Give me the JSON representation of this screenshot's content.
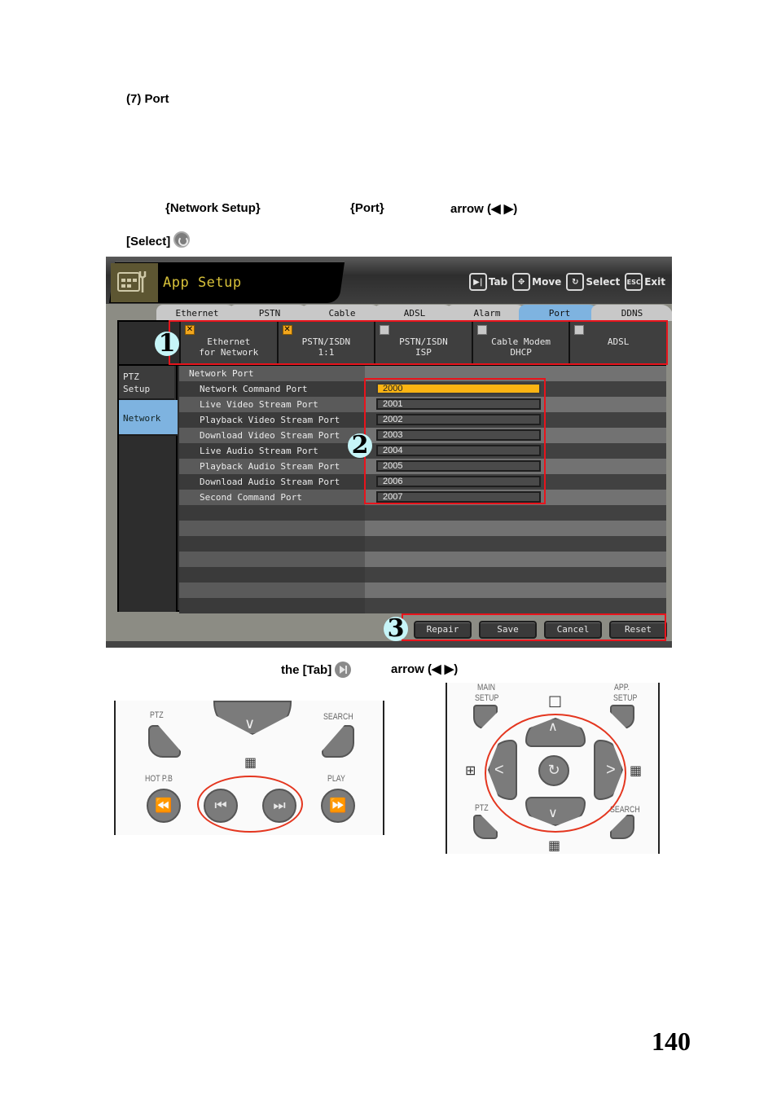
{
  "section_title": "(7) Port",
  "instructions": {
    "menu_path": "{Network Setup}",
    "menu_item": "{Port}",
    "arrow_text": "arrow (◀ ▶)",
    "select_label": "[Select]",
    "select_icon": "select-button-icon",
    "tab_text": "the [Tab]",
    "tab_icon": "tab-button-icon",
    "tab_arrow_text": "arrow (◀ ▶)"
  },
  "app": {
    "title": "App Setup",
    "title_icon": "app-setup-icon",
    "hints": [
      {
        "key": "▶|",
        "icon": "tab-key-icon",
        "label": "Tab"
      },
      {
        "key": "✥",
        "icon": "move-key-icon",
        "label": "Move"
      },
      {
        "key": "↻",
        "icon": "select-key-icon",
        "label": "Select"
      },
      {
        "key": "ESC",
        "icon": "esc-key-icon",
        "label": "Exit"
      }
    ],
    "tabs": [
      {
        "label": "Ethernet",
        "active": false
      },
      {
        "label": "PSTN",
        "active": false
      },
      {
        "label": "Cable",
        "active": false
      },
      {
        "label": "ADSL",
        "active": false
      },
      {
        "label": "Alarm",
        "active": false
      },
      {
        "label": "Port",
        "active": true
      },
      {
        "label": "DDNS",
        "active": false
      }
    ],
    "connections": [
      {
        "line1": "Ethernet",
        "line2": "for Network",
        "checked": true,
        "mark": "✕"
      },
      {
        "line1": "PSTN/ISDN",
        "line2": "1:1",
        "checked": true,
        "mark": "✕"
      },
      {
        "line1": "PSTN/ISDN",
        "line2": "ISP",
        "checked": false,
        "mark": ""
      },
      {
        "line1": "Cable Modem",
        "line2": "DHCP",
        "checked": false,
        "mark": ""
      },
      {
        "line1": "ADSL",
        "line2": "",
        "checked": false,
        "mark": ""
      }
    ],
    "sidebar": [
      {
        "label": "PTZ Setup",
        "active": false
      },
      {
        "label": "Network",
        "active": true
      }
    ],
    "group_header": "Network Port",
    "ports": [
      {
        "label": "Network Command Port",
        "value": "2000",
        "focused": true
      },
      {
        "label": "Live Video Stream Port",
        "value": "2001",
        "focused": false
      },
      {
        "label": "Playback Video Stream Port",
        "value": "2002",
        "focused": false
      },
      {
        "label": "Download Video Stream Port",
        "value": "2003",
        "focused": false
      },
      {
        "label": "Live Audio Stream Port",
        "value": "2004",
        "focused": false
      },
      {
        "label": "Playback Audio Stream Port",
        "value": "2005",
        "focused": false
      },
      {
        "label": "Download Audio Stream Port",
        "value": "2006",
        "focused": false
      },
      {
        "label": "Second Command Port",
        "value": "2007",
        "focused": false
      }
    ],
    "buttons": {
      "repair": "Repair",
      "save": "Save",
      "cancel": "Cancel",
      "reset": "Reset"
    },
    "colors": {
      "accent_blue": "#7eb3e0",
      "focus_orange": "#fbb413",
      "title_yellow": "#d8c23a",
      "annotation_red": "#e8141c"
    }
  },
  "callouts": [
    "1",
    "2",
    "3"
  ],
  "remote_left": {
    "labels": {
      "ptz": "PTZ",
      "search": "SEARCH",
      "hot": "HOT P.B",
      "play": "PLAY"
    },
    "buttons": [
      "rewind",
      "prev-tab",
      "next-tab",
      "fast-forward"
    ]
  },
  "remote_right": {
    "labels": {
      "main_setup_1": "MAIN",
      "main_setup_2": "SETUP",
      "app_setup_1": "APP.",
      "app_setup_2": "SETUP",
      "ptz": "PTZ",
      "search": "SEARCH"
    }
  },
  "page_number": "140"
}
